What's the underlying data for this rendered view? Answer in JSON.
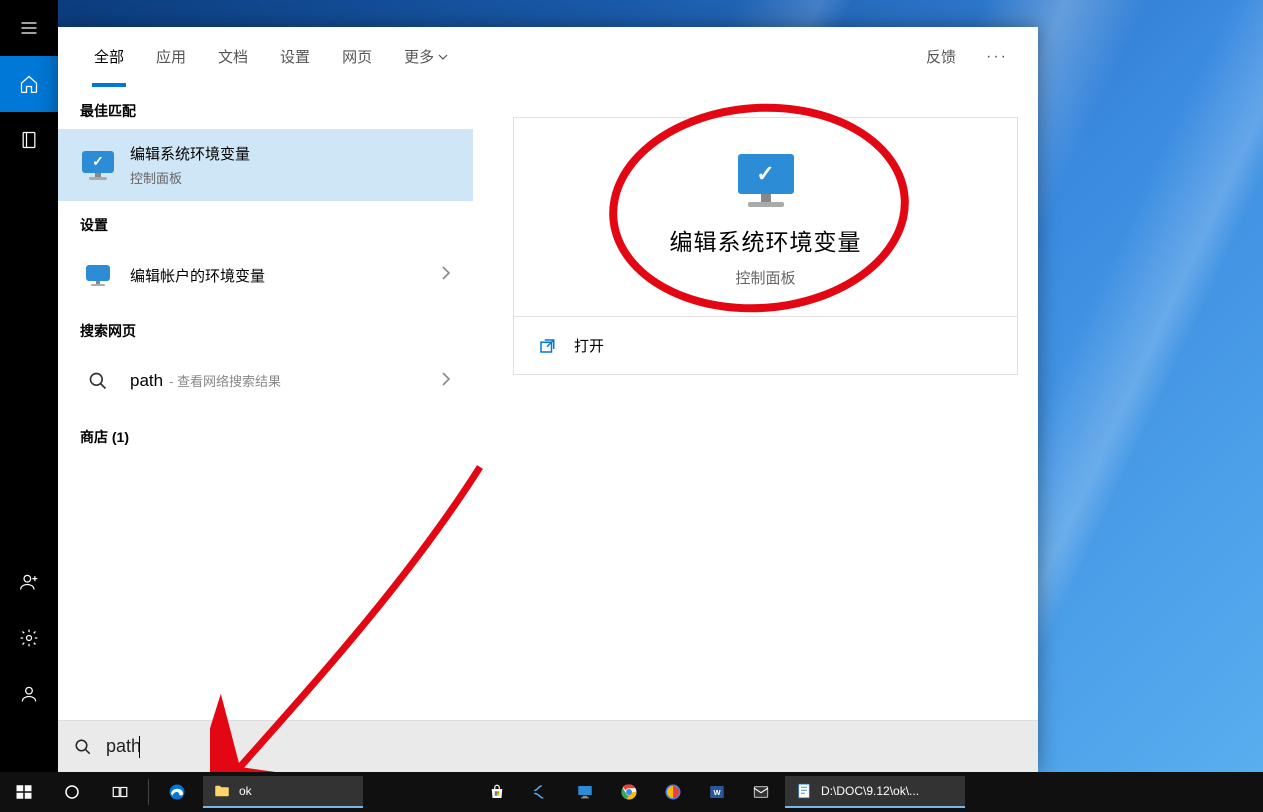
{
  "left_rail": {
    "menu": "menu",
    "home": "home",
    "notebook": "notebook",
    "people": "people",
    "settings": "settings",
    "account": "account"
  },
  "tabs": {
    "all": "全部",
    "apps": "应用",
    "documents": "文档",
    "settings": "设置",
    "web": "网页",
    "more": "更多",
    "feedback": "反馈",
    "dots": "···"
  },
  "sections": {
    "best_match": "最佳匹配",
    "settings": "设置",
    "search_web": "搜索网页",
    "store": "商店 (1)"
  },
  "results": {
    "env_edit": {
      "title": "编辑系统环境变量",
      "sub": "控制面板"
    },
    "account_env": {
      "title": "编辑帐户的环境变量"
    },
    "web": {
      "query": "path",
      "hint": "- 查看网络搜索结果"
    }
  },
  "preview": {
    "title": "编辑系统环境变量",
    "sub": "控制面板",
    "open": "打开"
  },
  "search": {
    "value": "path"
  },
  "taskbar": {
    "explorer_label": "ok",
    "notepad_label": "D:\\DOC\\9.12\\ok\\..."
  }
}
